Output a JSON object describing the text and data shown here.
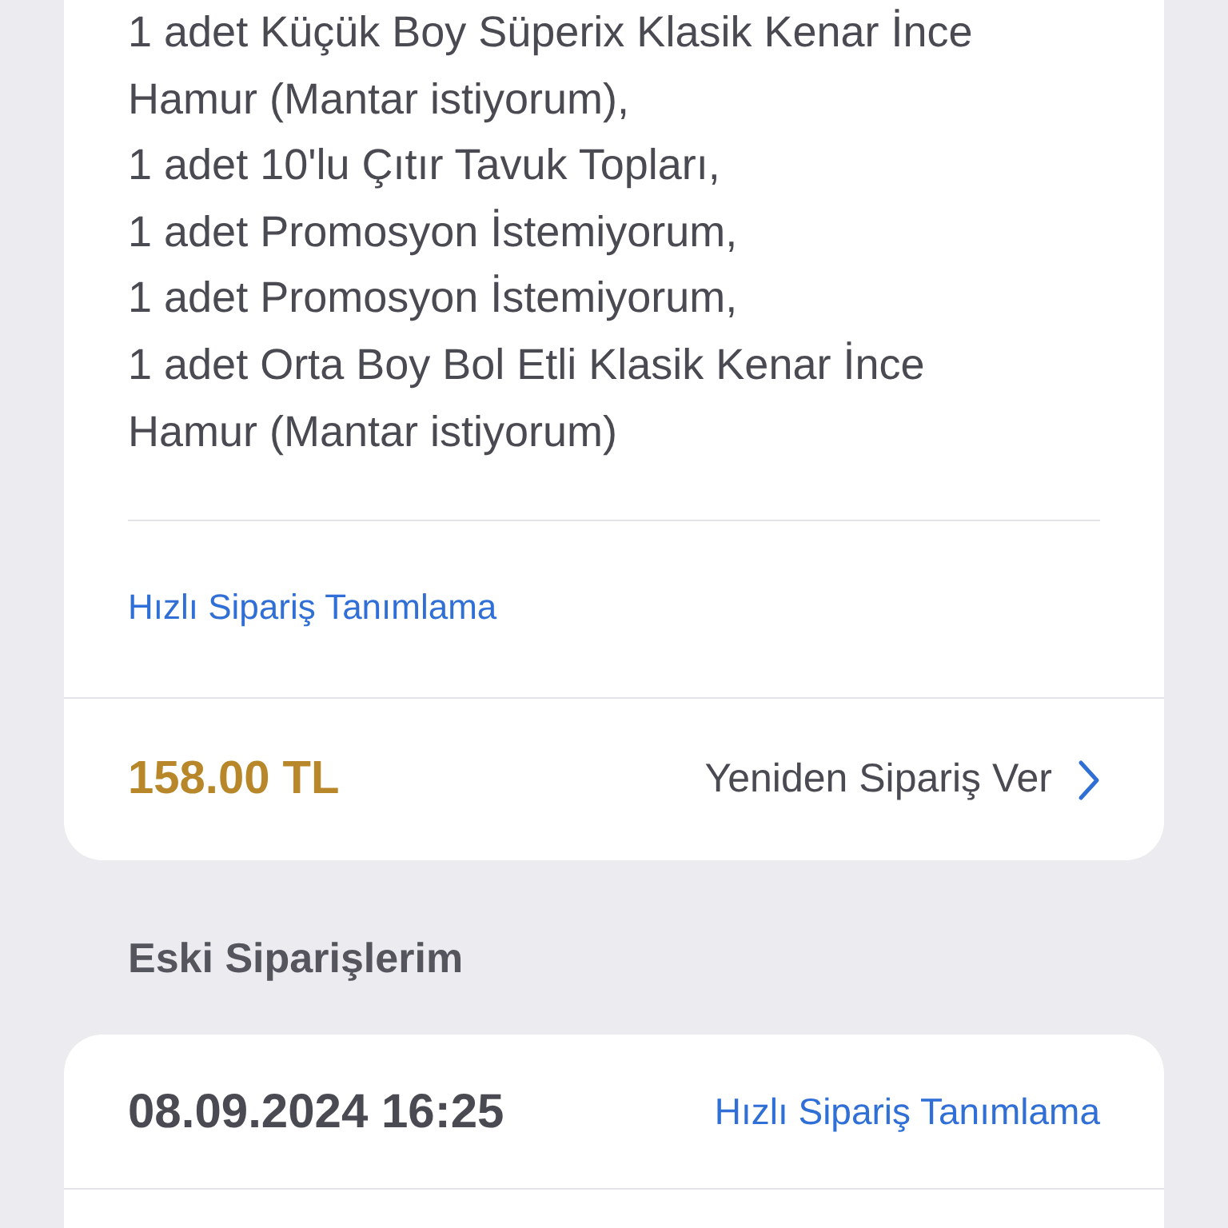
{
  "current_order": {
    "items": [
      "1 adet Küçük Boy Süperix Klasik Kenar İnce Hamur (Mantar istiyorum),",
      "1 adet 10'lu Çıtır Tavuk Topları,",
      "1 adet Promosyon İstemiyorum,",
      "1 adet Promosyon İstemiyorum,",
      "1 adet Orta Boy Bol Etli Klasik Kenar İnce Hamur (Mantar istiyorum)"
    ],
    "quick_order_link": "Hızlı Sipariş Tanımlama",
    "price": "158.00 TL",
    "reorder_button": "Yeniden Sipariş Ver"
  },
  "past_orders_title": "Eski Siparişlerim",
  "past_orders": [
    {
      "date": "08.09.2024 16:25",
      "quick_order_link": "Hızlı Sipariş Tanımlama"
    }
  ]
}
